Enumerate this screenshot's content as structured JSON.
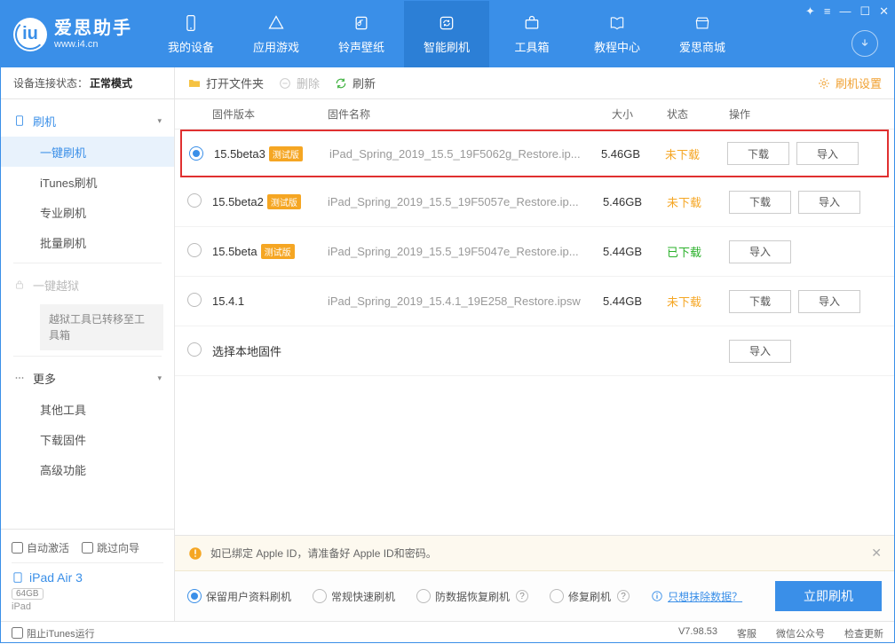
{
  "app": {
    "title": "爱思助手",
    "url": "www.i4.cn"
  },
  "nav": {
    "items": [
      {
        "label": "我的设备"
      },
      {
        "label": "应用游戏"
      },
      {
        "label": "铃声壁纸"
      },
      {
        "label": "智能刷机"
      },
      {
        "label": "工具箱"
      },
      {
        "label": "教程中心"
      },
      {
        "label": "爱思商城"
      }
    ]
  },
  "sidebar": {
    "conn_label": "设备连接状态：",
    "conn_mode": "正常模式",
    "group_flash": "刷机",
    "sub_oneclick": "一键刷机",
    "sub_itunes": "iTunes刷机",
    "sub_pro": "专业刷机",
    "sub_batch": "批量刷机",
    "group_jb": "一键越狱",
    "jb_notice": "越狱工具已转移至工具箱",
    "group_more": "更多",
    "sub_othertools": "其他工具",
    "sub_dlfw": "下载固件",
    "sub_adv": "高级功能",
    "chk_auto": "自动激活",
    "chk_skip": "跳过向导",
    "device_name": "iPad Air 3",
    "device_cap": "64GB",
    "device_type": "iPad"
  },
  "toolbar": {
    "open": "打开文件夹",
    "delete": "删除",
    "refresh": "刷新",
    "settings": "刷机设置"
  },
  "table": {
    "h_ver": "固件版本",
    "h_name": "固件名称",
    "h_size": "大小",
    "h_status": "状态",
    "h_ops": "操作",
    "beta_tag": "测试版",
    "btn_download": "下载",
    "btn_import": "导入",
    "local_label": "选择本地固件",
    "rows": [
      {
        "ver": "15.5beta3",
        "beta": true,
        "name": "iPad_Spring_2019_15.5_19F5062g_Restore.ip...",
        "size": "5.46GB",
        "status": "未下载",
        "status_class": "not",
        "selected": true,
        "highlight": true
      },
      {
        "ver": "15.5beta2",
        "beta": true,
        "name": "iPad_Spring_2019_15.5_19F5057e_Restore.ip...",
        "size": "5.46GB",
        "status": "未下载",
        "status_class": "not"
      },
      {
        "ver": "15.5beta",
        "beta": true,
        "name": "iPad_Spring_2019_15.5_19F5047e_Restore.ip...",
        "size": "5.44GB",
        "status": "已下载",
        "status_class": "done"
      },
      {
        "ver": "15.4.1",
        "beta": false,
        "name": "iPad_Spring_2019_15.4.1_19E258_Restore.ipsw",
        "size": "5.44GB",
        "status": "未下载",
        "status_class": "not"
      }
    ]
  },
  "bottom": {
    "warn": "如已绑定 Apple ID，请准备好 Apple ID和密码。",
    "opt_keep": "保留用户资料刷机",
    "opt_normal": "常规快速刷机",
    "opt_recover": "防数据恢复刷机",
    "opt_repair": "修复刷机",
    "erase_link": "只想抹除数据？",
    "flash_btn": "立即刷机"
  },
  "statusbar": {
    "block_itunes": "阻止iTunes运行",
    "version": "V7.98.53",
    "support": "客服",
    "wechat": "微信公众号",
    "update": "检查更新"
  }
}
